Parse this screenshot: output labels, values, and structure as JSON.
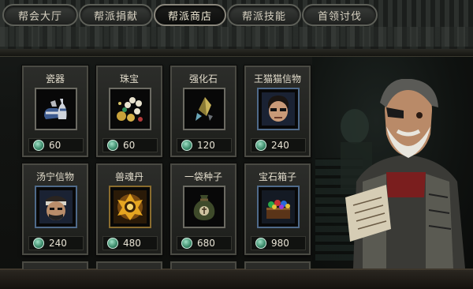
{
  "tabs": [
    {
      "label": "帮会大厅",
      "active": false
    },
    {
      "label": "帮派捐献",
      "active": false
    },
    {
      "label": "帮派商店",
      "active": true
    },
    {
      "label": "帮派技能",
      "active": false
    },
    {
      "label": "首领讨伐",
      "active": false
    }
  ],
  "currency_icon": "jade-coin-icon",
  "accent_colors": {
    "coin": "#3b8a6a",
    "active_tab_border": "#8a877c",
    "card_border": "#4a4a43"
  },
  "shop_items": [
    {
      "name": "瓷器",
      "price": "60",
      "icon": "porcelain-icon"
    },
    {
      "name": "珠宝",
      "price": "60",
      "icon": "jewels-icon"
    },
    {
      "name": "强化石",
      "price": "120",
      "icon": "upgrade-stone-icon"
    },
    {
      "name": "王猫猫信物",
      "price": "240",
      "icon": "wang-maomao-token-icon"
    },
    {
      "name": "汤宁信物",
      "price": "240",
      "icon": "tang-ning-token-icon"
    },
    {
      "name": "兽魂丹",
      "price": "480",
      "icon": "beast-soul-pill-icon"
    },
    {
      "name": "一袋种子",
      "price": "680",
      "icon": "seed-bag-icon"
    },
    {
      "name": "宝石箱子",
      "price": "980",
      "icon": "gem-chest-icon"
    }
  ]
}
